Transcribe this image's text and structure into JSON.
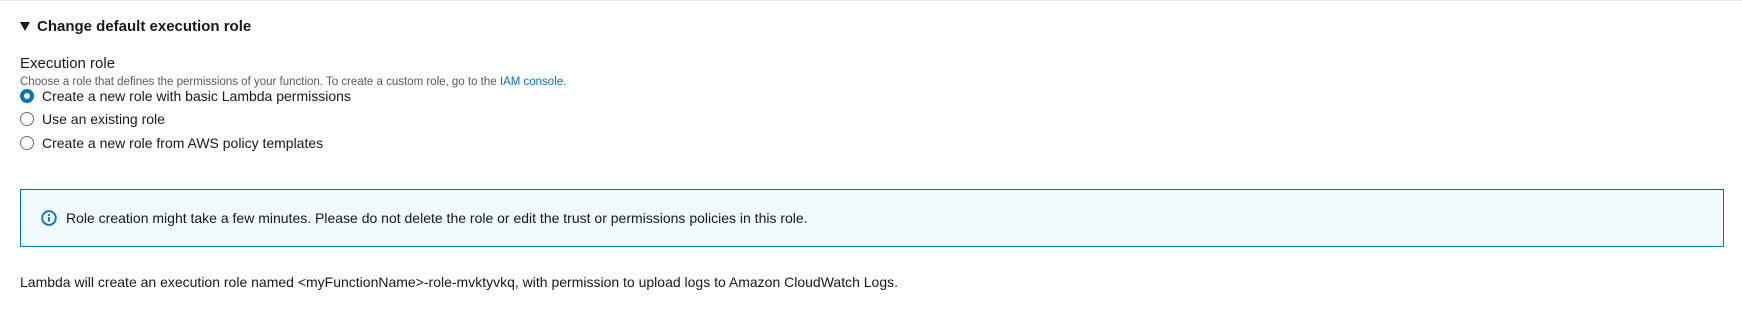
{
  "section": {
    "title": "Change default execution role",
    "expanded": true
  },
  "execution_role": {
    "label": "Execution role",
    "description_prefix": "Choose a role that defines the permissions of your function. To create a custom role, go to the ",
    "description_link": "IAM console",
    "description_suffix": ".",
    "options": [
      {
        "label": "Create a new role with basic Lambda permissions",
        "selected": true
      },
      {
        "label": "Use an existing role",
        "selected": false
      },
      {
        "label": "Create a new role from AWS policy templates",
        "selected": false
      }
    ]
  },
  "alert": {
    "icon": "info-icon",
    "text": "Role creation might take a few minutes. Please do not delete the role or edit the trust or permissions policies in this role."
  },
  "footer": {
    "text": "Lambda will create an execution role named <myFunctionName>-role-mvktyvkq, with permission to upload logs to Amazon CloudWatch Logs."
  },
  "colors": {
    "accent": "#0073bb",
    "alert_bg": "#f1faff",
    "text": "#16191f",
    "muted": "#545b64"
  }
}
